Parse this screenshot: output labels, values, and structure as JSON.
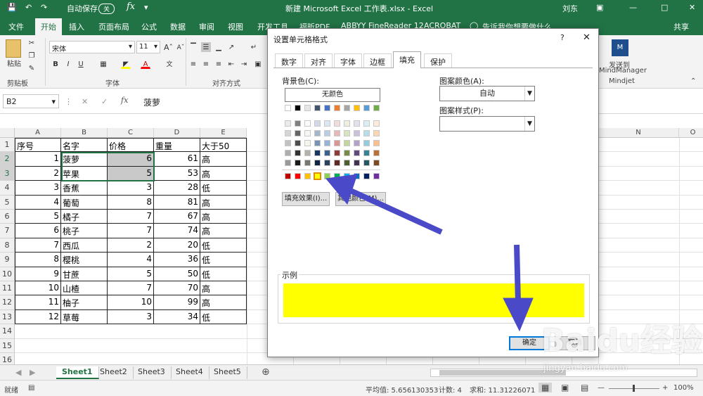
{
  "titlebar": {
    "autosave": "自动保存",
    "autosave_state": "关",
    "title": "新建 Microsoft Excel 工作表.xlsx - Excel",
    "user": "刘东",
    "color": "#217346"
  },
  "ribbon_tabs": [
    "文件",
    "开始",
    "插入",
    "页面布局",
    "公式",
    "数据",
    "审阅",
    "视图",
    "开发工具",
    "福昕PDF",
    "ABBYY FineReader 12",
    "ACROBAT"
  ],
  "ribbon_active_tab": "开始",
  "tell_me": "告诉我你想要做什么",
  "share": "共享",
  "ribbon": {
    "paste": "粘贴",
    "clipboard_group": "剪贴板",
    "font_name": "宋体",
    "font_size": "11",
    "font_group": "字体",
    "align_group": "对齐方式",
    "mindjet_button": "发送到",
    "mindjet_button2": "MindManager",
    "mindjet_group": "Mindjet"
  },
  "namebox": "B2",
  "formula_value": "菠萝",
  "columns": [
    "A",
    "B",
    "C",
    "D",
    "E",
    "N",
    "O"
  ],
  "rows": [
    {
      "n": "1",
      "a": "序号",
      "b": "名字",
      "c": "价格",
      "d": "重量",
      "e": "大于50"
    },
    {
      "n": "2",
      "a": "1",
      "b": "菠萝",
      "c": "6",
      "d": "61",
      "e": "高"
    },
    {
      "n": "3",
      "a": "2",
      "b": "苹果",
      "c": "5",
      "d": "53",
      "e": "高"
    },
    {
      "n": "4",
      "a": "3",
      "b": "香蕉",
      "c": "3",
      "d": "28",
      "e": "低"
    },
    {
      "n": "5",
      "a": "4",
      "b": "葡萄",
      "c": "8",
      "d": "81",
      "e": "高"
    },
    {
      "n": "6",
      "a": "5",
      "b": "橘子",
      "c": "7",
      "d": "67",
      "e": "高"
    },
    {
      "n": "7",
      "a": "6",
      "b": "桃子",
      "c": "7",
      "d": "74",
      "e": "高"
    },
    {
      "n": "8",
      "a": "7",
      "b": "西瓜",
      "c": "2",
      "d": "20",
      "e": "低"
    },
    {
      "n": "9",
      "a": "8",
      "b": "樱桃",
      "c": "4",
      "d": "36",
      "e": "低"
    },
    {
      "n": "10",
      "a": "9",
      "b": "甘蔗",
      "c": "5",
      "d": "50",
      "e": "低"
    },
    {
      "n": "11",
      "a": "10",
      "b": "山楂",
      "c": "7",
      "d": "70",
      "e": "高"
    },
    {
      "n": "12",
      "a": "11",
      "b": "柚子",
      "c": "10",
      "d": "99",
      "e": "高"
    },
    {
      "n": "13",
      "a": "12",
      "b": "草莓",
      "c": "3",
      "d": "34",
      "e": "低"
    },
    {
      "n": "14",
      "a": "",
      "b": "",
      "c": "",
      "d": "",
      "e": ""
    },
    {
      "n": "15",
      "a": "",
      "b": "",
      "c": "",
      "d": "",
      "e": ""
    },
    {
      "n": "16",
      "a": "",
      "b": "",
      "c": "",
      "d": "",
      "e": ""
    }
  ],
  "sheets": [
    "Sheet1",
    "Sheet2",
    "Sheet3",
    "Sheet4",
    "Sheet5"
  ],
  "status": {
    "ready": "就绪",
    "average": "平均值: 5.656130353",
    "count": "计数: 4",
    "sum": "求和: 11.31226071",
    "zoom": "100%"
  },
  "dialog": {
    "title": "设置单元格格式",
    "help": "?",
    "tabs": [
      "数字",
      "对齐",
      "字体",
      "边框",
      "填充",
      "保护"
    ],
    "active_tab": "填充",
    "bg_color_label": "背景色(C):",
    "no_color": "无颜色",
    "pattern_color_label": "图案颜色(A):",
    "pattern_color_value": "自动",
    "pattern_style_label": "图案样式(P):",
    "fill_effects": "填充效果(I)...",
    "more_colors": "其他颜色(M)...",
    "sample_label": "示例",
    "sample_color": "#ffff00",
    "ok": "确定",
    "cancel": "取消",
    "theme_top": [
      "#ffffff",
      "#000000",
      "#e7e6e6",
      "#44546a",
      "#4472c4",
      "#ed7d31",
      "#a5a5a5",
      "#ffc000",
      "#5b9bd5",
      "#70ad47"
    ],
    "theme_top_b": [
      "#ffffff",
      "#000000",
      "#eeece1",
      "#1f497d",
      "#4f81bd",
      "#c0504d",
      "#9bbb59",
      "#8064a2",
      "#4bacc6",
      "#f79646"
    ],
    "standard": [
      "#c00000",
      "#ff0000",
      "#ffc000",
      "#ffff00",
      "#92d050",
      "#00b050",
      "#00b0f0",
      "#0070c0",
      "#002060",
      "#7030a0"
    ]
  },
  "watermark": {
    "brand": "Baidu经验",
    "url": "jingyan.baidu.com"
  }
}
